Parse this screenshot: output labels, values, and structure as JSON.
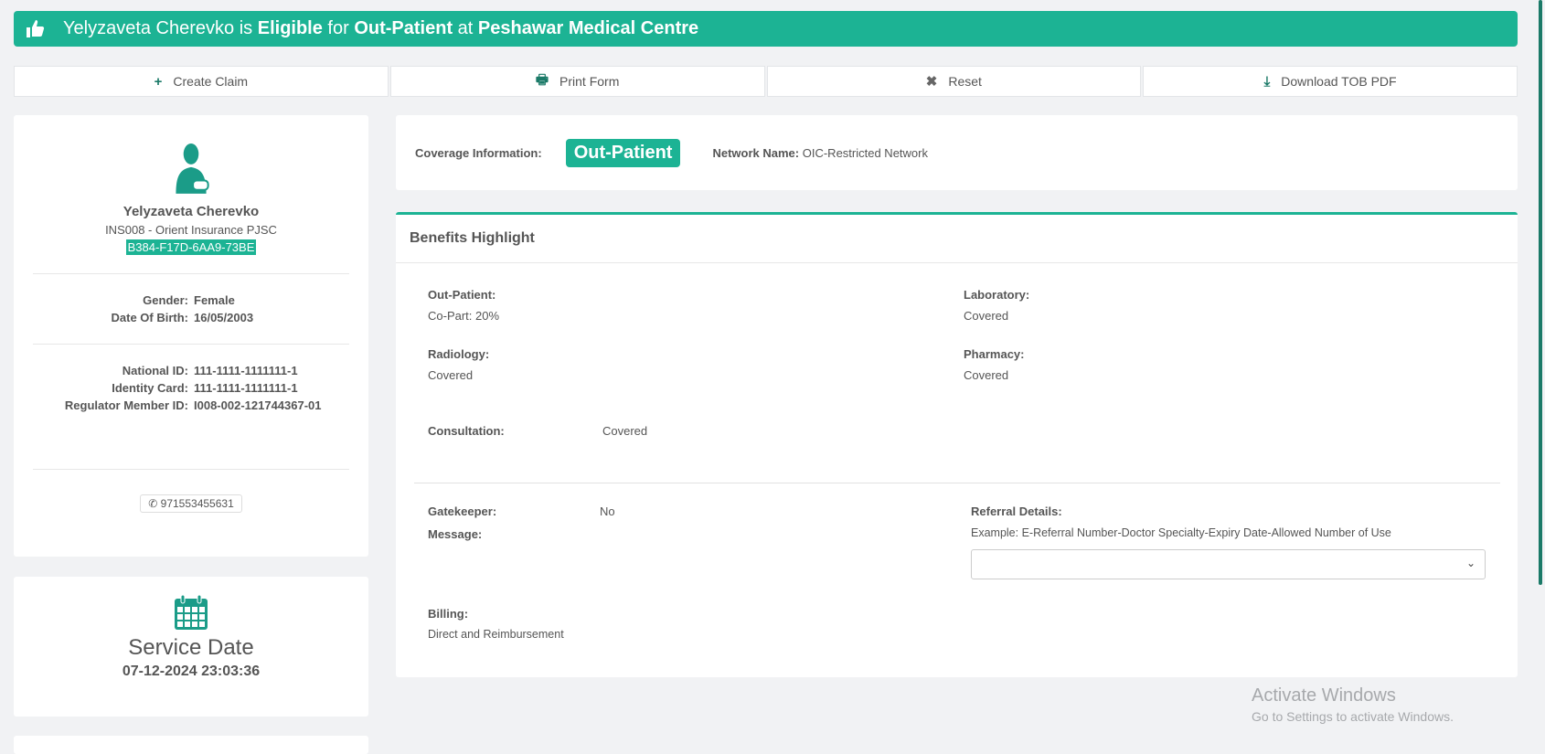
{
  "banner": {
    "name": "Yelyzaveta Cherevko",
    "is": "is",
    "status": "Eligible",
    "for": "for",
    "coverage": "Out-Patient",
    "at": "at",
    "provider": "Peshawar Medical Centre"
  },
  "actions": [
    {
      "label": "Create Claim",
      "icon": "+"
    },
    {
      "label": "Print Form",
      "icon": "🖶"
    },
    {
      "label": "Reset",
      "icon": "✖"
    },
    {
      "label": "Download TOB PDF",
      "icon": "⤓"
    }
  ],
  "member": {
    "name": "Yelyzaveta Cherevko",
    "insurer": "INS008 - Orient Insurance PJSC",
    "uid": "B384-F17D-6AA9-73BE",
    "gender_label": "Gender:",
    "gender": "Female",
    "dob_label": "Date Of Birth:",
    "dob": "16/05/2003",
    "national_id_label": "National ID:",
    "national_id": "111-1111-1111111-1",
    "identity_card_label": "Identity Card:",
    "identity_card": "111-1111-1111111-1",
    "regulator_label": "Regulator Member ID:",
    "regulator_id": "I008-002-121744367-01",
    "phone": "971553455631"
  },
  "service": {
    "title": "Service Date",
    "date": "07-12-2024 23:03:36"
  },
  "coverage": {
    "label": "Coverage Information:",
    "type": "Out-Patient",
    "network_label": "Network Name:",
    "network": "OIC-Restricted Network"
  },
  "benefits": {
    "title": "Benefits Highlight",
    "outpatient_label": "Out-Patient:",
    "outpatient": "Co-Part: 20%",
    "laboratory_label": "Laboratory:",
    "laboratory": "Covered",
    "radiology_label": "Radiology:",
    "radiology": "Covered",
    "pharmacy_label": "Pharmacy:",
    "pharmacy": "Covered",
    "consultation_label": "Consultation:",
    "consultation": "Covered",
    "gatekeeper_label": "Gatekeeper:",
    "gatekeeper": "No",
    "message_label": "Message:",
    "referral_label": "Referral Details:",
    "referral_example": "Example: E-Referral Number-Doctor Specialty-Expiry Date-Allowed Number of Use",
    "billing_label": "Billing:",
    "billing": "Direct and Reimbursement"
  },
  "watermark": {
    "title": "Activate Windows",
    "sub": "Go to Settings to activate Windows."
  },
  "colors": {
    "accent": "#1cb394",
    "icon": "#1b7a68"
  }
}
